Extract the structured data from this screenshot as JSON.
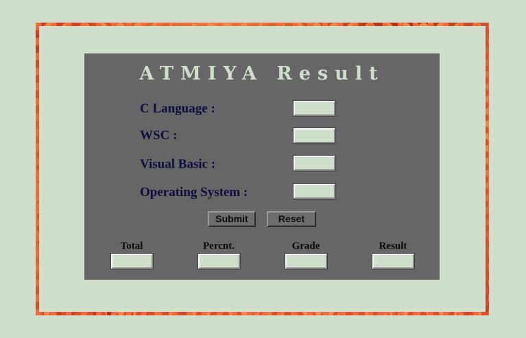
{
  "title": "ATMIYA Result",
  "subjects": [
    {
      "label": "C Language :",
      "value": ""
    },
    {
      "label": "WSC :",
      "value": ""
    },
    {
      "label": "Visual Basic :",
      "value": ""
    },
    {
      "label": "Operating System :",
      "value": ""
    }
  ],
  "buttons": {
    "submit": "Submit",
    "reset": "Reset"
  },
  "summary": [
    {
      "label": "Total",
      "value": ""
    },
    {
      "label": "Percnt.",
      "value": ""
    },
    {
      "label": "Grade",
      "value": ""
    },
    {
      "label": "Result",
      "value": ""
    }
  ],
  "colors": {
    "page_bg": "#cfdfcb",
    "panel_bg": "#666666",
    "label_color": "#0e0e3e",
    "border_accent": "#c8321c"
  }
}
